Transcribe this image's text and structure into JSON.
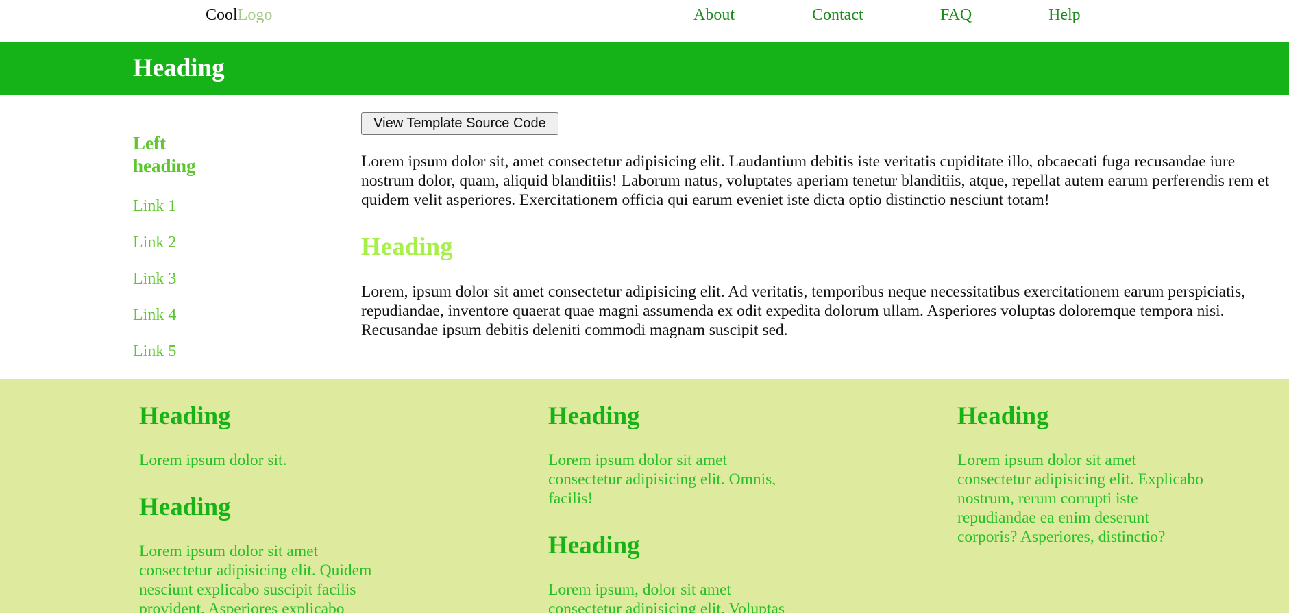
{
  "nav": {
    "logo_first": "Cool",
    "logo_second": "Logo",
    "links": [
      "About",
      "Contact",
      "FAQ",
      "Help"
    ]
  },
  "banner": {
    "heading": "Heading"
  },
  "sidebar": {
    "heading_line1": "Left",
    "heading_line2": "heading",
    "links": [
      "Link 1",
      "Link 2",
      "Link 3",
      "Link 4",
      "Link 5"
    ]
  },
  "main": {
    "button_label": "View Template Source Code",
    "paragraph1": "Lorem ipsum dolor sit, amet consectetur adipisicing elit. Laudantium debitis iste veritatis cupiditate illo, obcaecati fuga recusandae iure nostrum dolor, quam, aliquid blanditiis! Laborum natus, voluptates aperiam tenetur blanditiis, atque, repellat autem earum perferendis rem et quidem velit asperiores. Exercitationem officia qui earum eveniet iste dicta optio distinctio nesciunt totam!",
    "heading": "Heading",
    "paragraph2": "Lorem, ipsum dolor sit amet consectetur adipisicing elit. Ad veritatis, temporibus neque necessitatibus exercitationem earum perspiciatis, repudiandae, inventore quaerat quae magni assumenda ex odit expedita dolorum ullam. Asperiores voluptas doloremque tempora nisi. Recusandae ipsum debitis deleniti commodi magnam suscipit sed."
  },
  "footer": {
    "col1": {
      "heading1": "Heading",
      "text1": "Lorem ipsum dolor sit.",
      "heading2": "Heading",
      "text2": "Lorem ipsum dolor sit amet consectetur adipisicing elit. Quidem nesciunt explicabo suscipit facilis provident. Asperiores explicabo"
    },
    "col2": {
      "heading1": "Heading",
      "text1": "Lorem ipsum dolor sit amet consectetur adipisicing elit. Omnis, facilis!",
      "heading2": "Heading",
      "text2": "Lorem ipsum, dolor sit amet consectetur adipisicing elit. Voluptas"
    },
    "col3": {
      "heading1": "Heading",
      "text1": "Lorem ipsum dolor sit amet consectetur adipisicing elit. Explicabo nostrum, rerum corrupti iste repudiandae ea enim deserunt corporis? Asperiores, distinctio?"
    }
  }
}
